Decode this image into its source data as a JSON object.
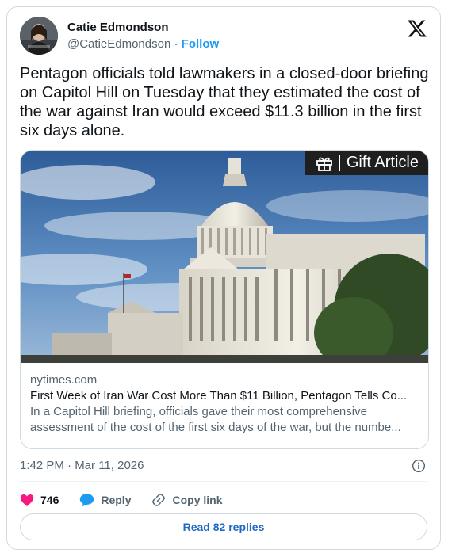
{
  "author": {
    "name": "Catie Edmondson",
    "handle": "@CatieEdmondson",
    "separator": " · ",
    "follow_label": "Follow"
  },
  "tweet": {
    "text": "Pentagon officials told lawmakers in a closed-door briefing on Capitol Hill on Tuesday that they estimated the cost of the war against Iran would exceed $11.3 billion in the first six days alone."
  },
  "link_card": {
    "badge_label": "Gift Article",
    "domain": "nytimes.com",
    "headline": "First Week of Iran War Cost More Than $11 Billion, Pentagon Tells Co...",
    "description_line1": "In a Capitol Hill briefing, officials gave their most comprehensive",
    "description_line2": "assessment of the cost of the first six days of the war, but the numbe..."
  },
  "meta": {
    "timestamp": "1:42 PM · Mar 11, 2026"
  },
  "actions": {
    "like_count": "746",
    "reply_label": "Reply",
    "copy_link_label": "Copy link"
  },
  "read_replies_label": "Read 82 replies",
  "colors": {
    "accent": "#1d9bf0",
    "like": "#f91880",
    "text": "#0f1419",
    "muted": "#536471",
    "border": "#cfd9de"
  },
  "icons": [
    "x-logo-icon",
    "gift-icon",
    "heart-icon",
    "reply-bubble-icon",
    "link-icon",
    "info-icon"
  ]
}
